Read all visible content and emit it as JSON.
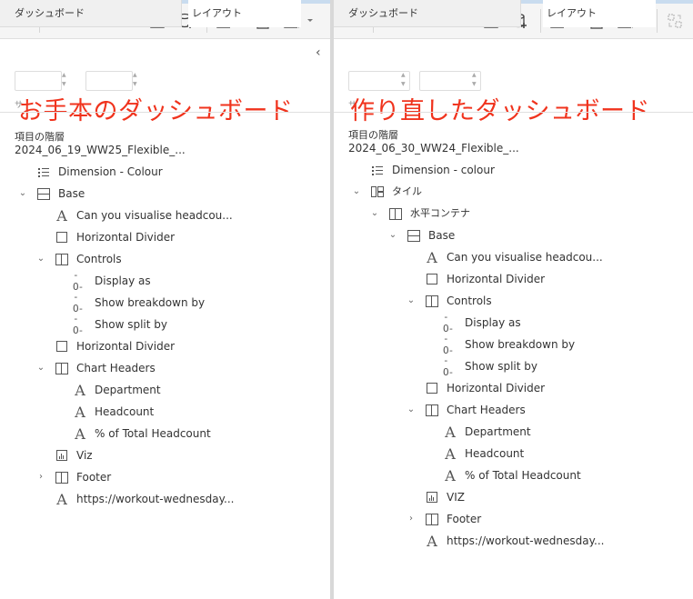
{
  "left_panel": {
    "tabs": {
      "dashboard": "ダッシュボード",
      "layout": "レイアウト"
    },
    "overlay_label": "お手本のダッシュボード",
    "size_label": "サ",
    "section_title": "項目の階層",
    "dashboard_name": "2024_06_19_WW25_Flexible_...",
    "tree": [
      {
        "label": "Dimension - Colour",
        "icon": "legend-icon"
      },
      {
        "label": "Base",
        "icon": "horizontal-container-icon",
        "chevron": "expanded"
      },
      {
        "label": "Can you visualise headcou...",
        "icon": "text-icon"
      },
      {
        "label": "Horizontal Divider",
        "icon": "blank-icon"
      },
      {
        "label": "Controls",
        "icon": "vertical-container-icon",
        "chevron": "expanded"
      },
      {
        "label": "Display as",
        "icon": "parameter-icon"
      },
      {
        "label": "Show breakdown by",
        "icon": "parameter-icon"
      },
      {
        "label": "Show split by",
        "icon": "parameter-icon"
      },
      {
        "label": "Horizontal Divider",
        "icon": "blank-icon"
      },
      {
        "label": "Chart Headers",
        "icon": "vertical-container-icon",
        "chevron": "expanded"
      },
      {
        "label": "Department",
        "icon": "text-icon"
      },
      {
        "label": "Headcount",
        "icon": "text-icon"
      },
      {
        "label": "% of Total Headcount",
        "icon": "text-icon"
      },
      {
        "label": "Viz",
        "icon": "viz-icon"
      },
      {
        "label": "Footer",
        "icon": "vertical-container-icon",
        "chevron": "collapsed"
      },
      {
        "label": "https://workout-wednesday...",
        "icon": "text-icon"
      }
    ]
  },
  "right_panel": {
    "tabs": {
      "dashboard": "ダッシュボード",
      "layout": "レイアウト"
    },
    "overlay_label": "作り直したダッシュボード",
    "size_label": "サ",
    "section_title": "項目の階層",
    "dashboard_name": "2024_06_30_WW24_Flexible_...",
    "tree": [
      {
        "label": "Dimension - colour",
        "icon": "legend-icon"
      },
      {
        "label": "タイル",
        "icon": "tiled-icon",
        "chevron": "expanded"
      },
      {
        "label": "水平コンテナ",
        "icon": "vertical-container-icon",
        "chevron": "expanded"
      },
      {
        "label": "Base",
        "icon": "horizontal-container-icon",
        "chevron": "expanded"
      },
      {
        "label": "Can you visualise headcou...",
        "icon": "text-icon"
      },
      {
        "label": "Horizontal Divider",
        "icon": "blank-icon"
      },
      {
        "label": "Controls",
        "icon": "vertical-container-icon",
        "chevron": "expanded"
      },
      {
        "label": "Display as",
        "icon": "parameter-icon"
      },
      {
        "label": "Show breakdown by",
        "icon": "parameter-icon"
      },
      {
        "label": "Show split by",
        "icon": "parameter-icon"
      },
      {
        "label": "Horizontal Divider",
        "icon": "blank-icon"
      },
      {
        "label": "Chart Headers",
        "icon": "vertical-container-icon",
        "chevron": "expanded"
      },
      {
        "label": "Department",
        "icon": "text-icon"
      },
      {
        "label": "Headcount",
        "icon": "text-icon"
      },
      {
        "label": "% of Total Headcount",
        "icon": "text-icon"
      },
      {
        "label": "VIZ",
        "icon": "viz-icon"
      },
      {
        "label": "Footer",
        "icon": "vertical-container-icon",
        "chevron": "collapsed"
      },
      {
        "label": "https://workout-wednesday...",
        "icon": "text-icon"
      }
    ]
  },
  "colors": {
    "overlay_text": "#f0331d",
    "accent_blue": "#1f77b4"
  }
}
